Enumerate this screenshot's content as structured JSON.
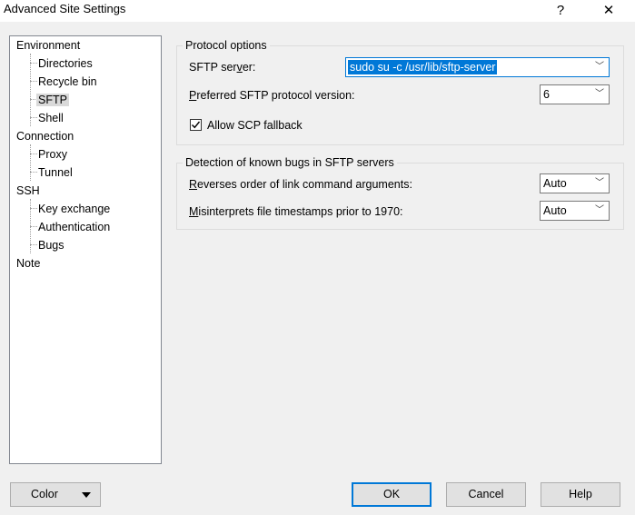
{
  "window": {
    "title": "Advanced Site Settings",
    "help_glyph": "?",
    "close_glyph": "✕"
  },
  "tree": {
    "environment": "Environment",
    "directories": "Directories",
    "recycle_bin": "Recycle bin",
    "sftp": "SFTP",
    "shell": "Shell",
    "connection": "Connection",
    "proxy": "Proxy",
    "tunnel": "Tunnel",
    "ssh": "SSH",
    "key_exchange": "Key exchange",
    "authentication": "Authentication",
    "bugs": "Bugs",
    "note": "Note",
    "selected": "SFTP"
  },
  "protocol_options": {
    "title": "Protocol options",
    "sftp_server_label_pre": "SFTP ser",
    "sftp_server_label_ul": "v",
    "sftp_server_label_post": "er:",
    "sftp_server_value": "sudo su -c /usr/lib/sftp-server",
    "pref_version_label_ul": "P",
    "pref_version_label_post": "referred SFTP protocol version:",
    "pref_version_value": "6",
    "allow_scp_label": "Allow SCP fallback",
    "allow_scp_checked": true
  },
  "bugs_detection": {
    "title": "Detection of known bugs in SFTP servers",
    "reverses_label_ul": "R",
    "reverses_label_post": "everses order of link command arguments:",
    "reverses_value": "Auto",
    "misinterprets_label_ul": "M",
    "misinterprets_label_post": "isinterprets file timestamps prior to 1970:",
    "misinterprets_value": "Auto"
  },
  "buttons": {
    "color": "Color",
    "ok": "OK",
    "cancel": "Cancel",
    "help": "Help"
  },
  "colors": {
    "accent": "#0078d7",
    "selection_background": "#d9d9d9"
  }
}
